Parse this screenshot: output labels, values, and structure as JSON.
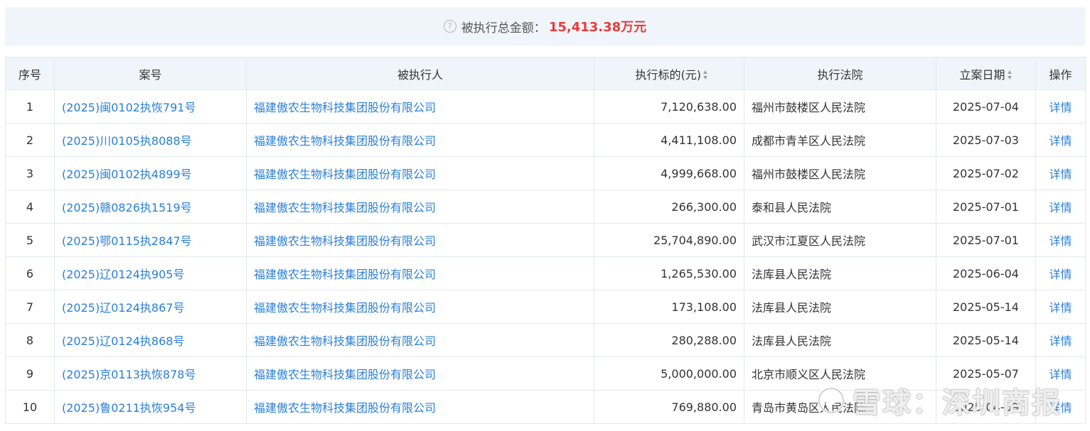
{
  "summary": {
    "label": "被执行总金额：",
    "amount": "15,413.38万元",
    "help_icon": "question-circle-icon"
  },
  "table": {
    "headers": {
      "idx": "序号",
      "case_no": "案号",
      "party": "被执行人",
      "amount": "执行标的(元)",
      "court": "执行法院",
      "date": "立案日期",
      "action": "操作"
    },
    "rows": [
      {
        "idx": "1",
        "case_no": "(2025)闽0102执恢791号",
        "party": "福建傲农生物科技集团股份有限公司",
        "amount": "7,120,638.00",
        "court": "福州市鼓楼区人民法院",
        "date": "2025-07-04",
        "action": "详情"
      },
      {
        "idx": "2",
        "case_no": "(2025)川0105执8088号",
        "party": "福建傲农生物科技集团股份有限公司",
        "amount": "4,411,108.00",
        "court": "成都市青羊区人民法院",
        "date": "2025-07-03",
        "action": "详情"
      },
      {
        "idx": "3",
        "case_no": "(2025)闽0102执4899号",
        "party": "福建傲农生物科技集团股份有限公司",
        "amount": "4,999,668.00",
        "court": "福州市鼓楼区人民法院",
        "date": "2025-07-02",
        "action": "详情"
      },
      {
        "idx": "4",
        "case_no": "(2025)赣0826执1519号",
        "party": "福建傲农生物科技集团股份有限公司",
        "amount": "266,300.00",
        "court": "泰和县人民法院",
        "date": "2025-07-01",
        "action": "详情"
      },
      {
        "idx": "5",
        "case_no": "(2025)鄂0115执2847号",
        "party": "福建傲农生物科技集团股份有限公司",
        "amount": "25,704,890.00",
        "court": "武汉市江夏区人民法院",
        "date": "2025-07-01",
        "action": "详情"
      },
      {
        "idx": "6",
        "case_no": "(2025)辽0124执905号",
        "party": "福建傲农生物科技集团股份有限公司",
        "amount": "1,265,530.00",
        "court": "法库县人民法院",
        "date": "2025-06-04",
        "action": "详情"
      },
      {
        "idx": "7",
        "case_no": "(2025)辽0124执867号",
        "party": "福建傲农生物科技集团股份有限公司",
        "amount": "173,108.00",
        "court": "法库县人民法院",
        "date": "2025-05-14",
        "action": "详情"
      },
      {
        "idx": "8",
        "case_no": "(2025)辽0124执868号",
        "party": "福建傲农生物科技集团股份有限公司",
        "amount": "280,288.00",
        "court": "法库县人民法院",
        "date": "2025-05-14",
        "action": "详情"
      },
      {
        "idx": "9",
        "case_no": "(2025)京0113执恢878号",
        "party": "福建傲农生物科技集团股份有限公司",
        "amount": "5,000,000.00",
        "court": "北京市顺义区人民法院",
        "date": "2025-05-07",
        "action": "详情"
      },
      {
        "idx": "10",
        "case_no": "(2025)鲁0211执恢954号",
        "party": "福建傲农生物科技集团股份有限公司",
        "amount": "769,880.00",
        "court": "青岛市黄岛区人民法院",
        "date": "2025-04-09",
        "action": "详情"
      }
    ]
  },
  "watermark": {
    "text": "雪球：深圳商报"
  },
  "colors": {
    "accent_link": "#2a7fd8",
    "amount_red": "#e93a3a",
    "header_bg": "#f0f5fc",
    "border": "#e4e8ee"
  }
}
